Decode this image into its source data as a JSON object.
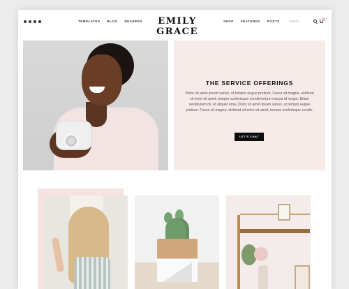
{
  "header": {
    "social_icons": [
      "facebook-icon",
      "instagram-icon",
      "pinterest-icon",
      "heart-icon"
    ],
    "nav_left": [
      "TEMPLATES",
      "BLOG",
      "READERS"
    ],
    "logo": "EMILY GRACE",
    "nav_right": [
      "SHOP",
      "FEATURES",
      "POSTS"
    ],
    "search_placeholder": "Search",
    "cart_count": "0"
  },
  "hero": {
    "photo_alt_icon": "portrait-photo",
    "service": {
      "title": "THE SERVICE OFFERINGS",
      "body": "Dolor sit amet ipsum varius, ut tempor augue pretium. Fusce sit magna, eleifend sit enim sit amet, tempor scelerisque condimentum massa id neque. Etiam vestibulum mi, et aliquet urna. Dolor sit amet ipsum varius, ut tempor augue pretium. Fusce sit magna, eleifend sit enim sit amet, tempor scelerisque condic.",
      "cta": "LET'S CHAT"
    }
  },
  "gallery": [
    "woman-photo",
    "cactus-photo",
    "shelf-photo"
  ],
  "colors": {
    "accent_pink": "#f6ebe9",
    "button": "#0d0d0d"
  }
}
